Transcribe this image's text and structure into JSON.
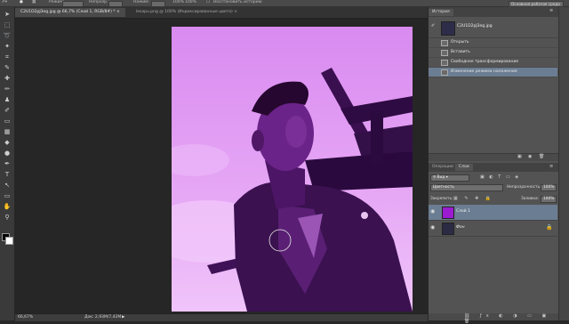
{
  "options_bar": {
    "mode_label": "Режим:",
    "opacity_label": "Непрозр.:",
    "opacity_value": "100%",
    "flow_label": "Нажим:",
    "flow_value": "100%",
    "erase_history_label": "Восстановить историю",
    "workspace_label": "Основная рабочая среда"
  },
  "tools": [
    {
      "name": "move-tool-icon",
      "glyph": "➤"
    },
    {
      "name": "marquee-tool-icon",
      "glyph": "⬚"
    },
    {
      "name": "lasso-tool-icon",
      "glyph": "➰"
    },
    {
      "name": "magic-wand-tool-icon",
      "glyph": "✦"
    },
    {
      "name": "crop-tool-icon",
      "glyph": "⌗"
    },
    {
      "name": "eyedropper-tool-icon",
      "glyph": "✎"
    },
    {
      "name": "healing-tool-icon",
      "glyph": "✚"
    },
    {
      "name": "brush-tool-icon",
      "glyph": "✏"
    },
    {
      "name": "stamp-tool-icon",
      "glyph": "♟"
    },
    {
      "name": "history-brush-tool-icon",
      "glyph": "✐"
    },
    {
      "name": "eraser-tool-icon",
      "glyph": "▭"
    },
    {
      "name": "gradient-tool-icon",
      "glyph": "▦"
    },
    {
      "name": "blur-tool-icon",
      "glyph": "◆"
    },
    {
      "name": "dodge-tool-icon",
      "glyph": "●"
    },
    {
      "name": "pen-tool-icon",
      "glyph": "✒"
    },
    {
      "name": "type-tool-icon",
      "glyph": "T"
    },
    {
      "name": "path-select-tool-icon",
      "glyph": "↖"
    },
    {
      "name": "shape-tool-icon",
      "glyph": "▭"
    },
    {
      "name": "hand-tool-icon",
      "glyph": "✋"
    },
    {
      "name": "zoom-tool-icon",
      "glyph": "⚲"
    }
  ],
  "tabs": [
    {
      "label": "C2U1D2pJ3eg.jpg @ 66,7% (Слой 1, RGB/8#) *"
    },
    {
      "label": "lesapu.png @ 100% (Индексированные цвета)"
    }
  ],
  "status": {
    "zoom": "66,67%",
    "doc_info": "Док: 2,93M/7,42M"
  },
  "history": {
    "tab_label": "История",
    "snapshot_label": "C2U1D2pJ3eg.jpg",
    "items": [
      {
        "label": "Открыть"
      },
      {
        "label": "Вставить"
      },
      {
        "label": "Свободное трансформирование"
      },
      {
        "label": "Изменение режима наложения"
      }
    ]
  },
  "layers_panel": {
    "tab_operations": "Операции",
    "tab_layers": "Слои",
    "kind_label": "Вид",
    "blend_mode": "Цветность",
    "opacity_label": "Непрозрачность:",
    "opacity_value": "100%",
    "lock_label": "Закрепить:",
    "fill_label": "Заливка:",
    "fill_value": "100%",
    "layers": [
      {
        "name": "Слой 1",
        "thumb_color": "#9c1bd0",
        "selected": true
      },
      {
        "name": "Фон",
        "thumb_color": "#2b2b44",
        "selected": false
      }
    ]
  },
  "colors": {
    "photo_tint": "#c86ee0",
    "accent_selected": "#6b7d92"
  }
}
